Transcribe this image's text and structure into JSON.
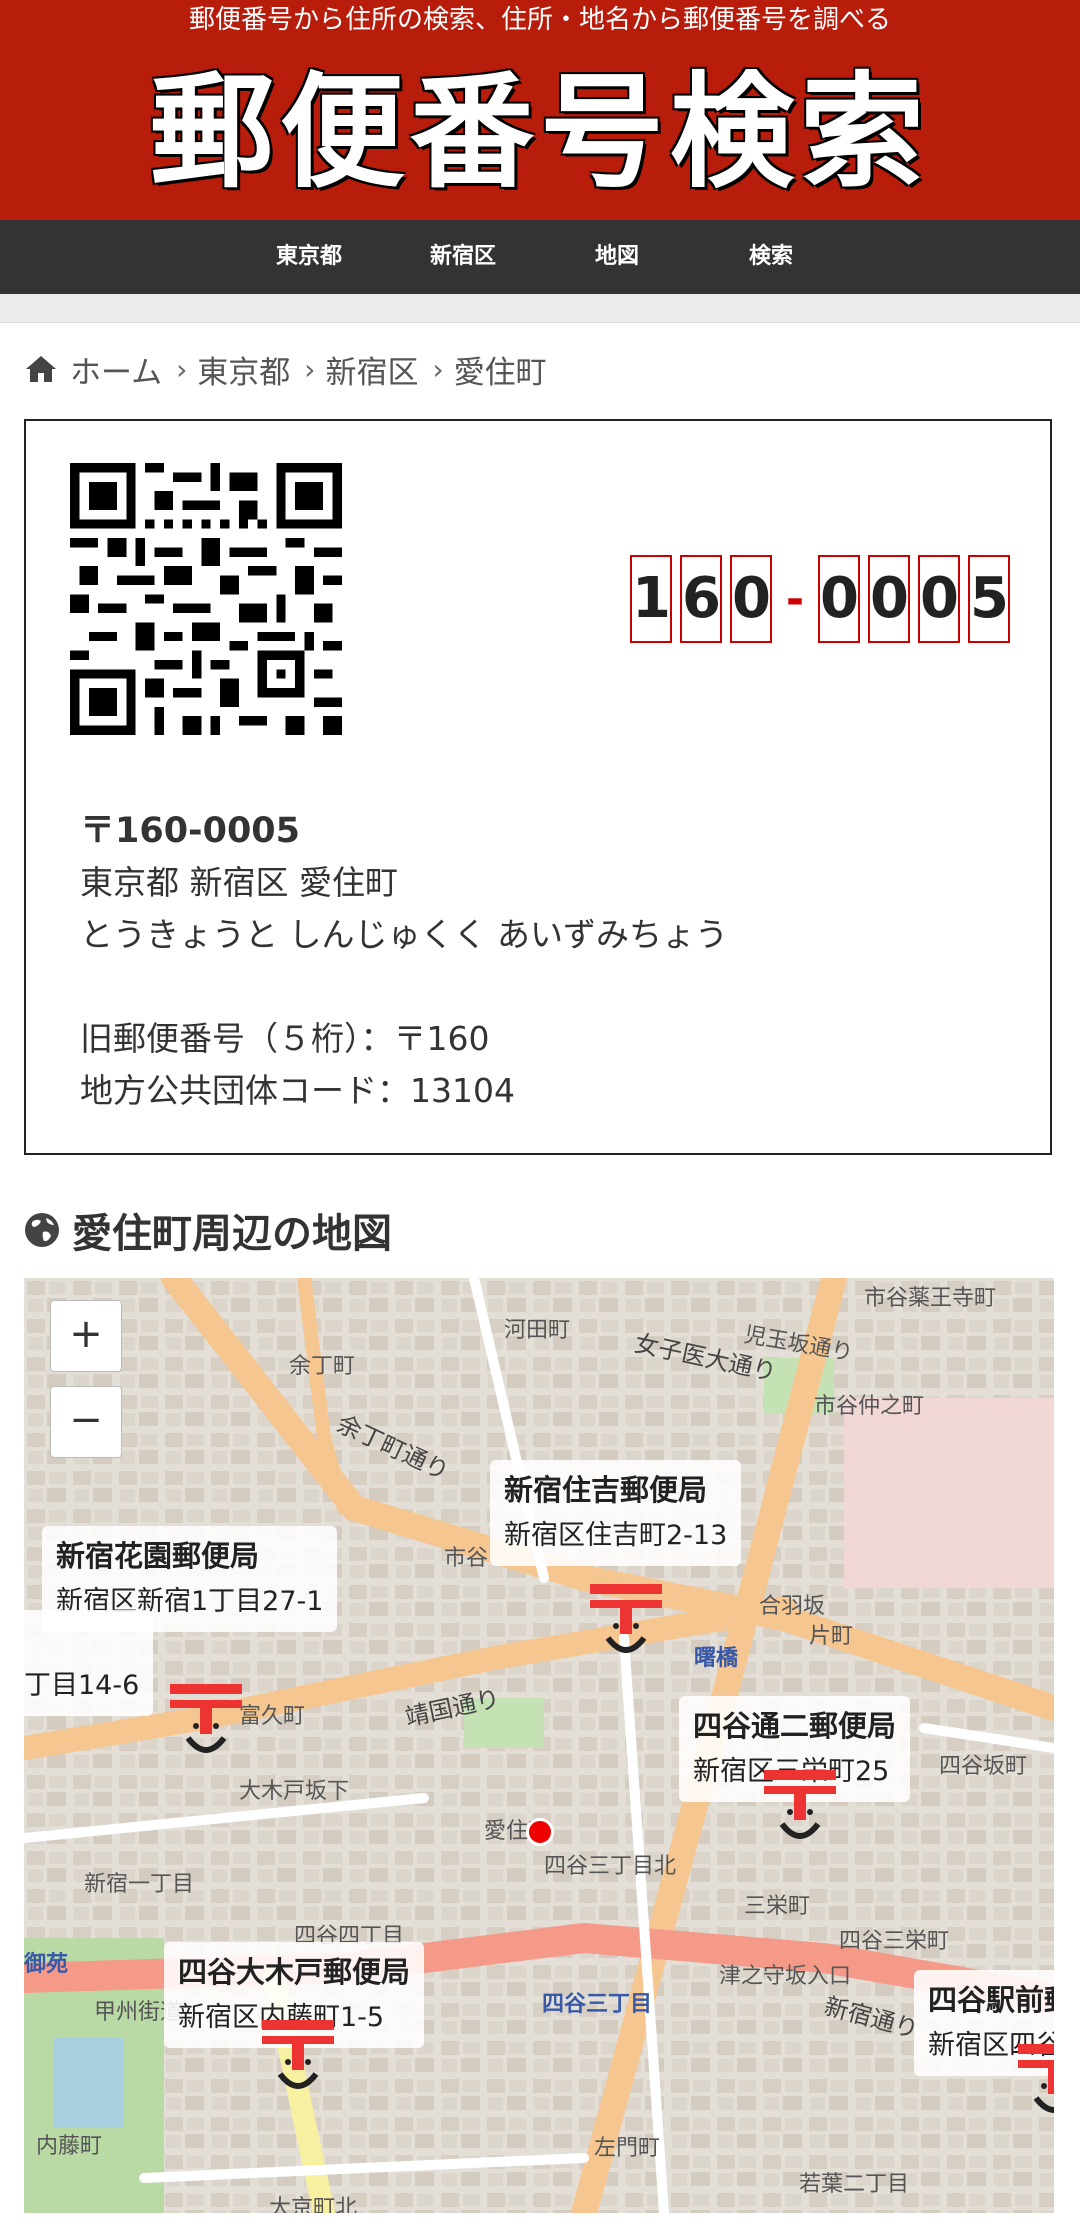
{
  "header": {
    "tagline": "郵便番号から住所の検索、住所・地名から郵便番号を調べる",
    "logo": "郵便番号検索",
    "color": "#b81c0b"
  },
  "nav": {
    "items": [
      {
        "label": "東京都"
      },
      {
        "label": "新宿区"
      },
      {
        "label": "地図"
      },
      {
        "label": "検索"
      }
    ]
  },
  "breadcrumb": {
    "home": "ホーム",
    "items": [
      "東京都",
      "新宿区",
      "愛住町"
    ]
  },
  "postal": {
    "digits": [
      "1",
      "6",
      "0",
      "0",
      "0",
      "0",
      "5"
    ],
    "zip_line": "〒160-0005",
    "address": "東京都 新宿区 愛住町",
    "reading": "とうきょうと しんじゅくく あいずみちょう",
    "old_zip": "旧郵便番号（５桁）：〒160",
    "local_code": "地方公共団体コード：13104"
  },
  "map": {
    "title": "愛住町周辺の地図",
    "zoom_in": "+",
    "zoom_out": "−",
    "popups": [
      {
        "name": "新宿住吉郵便局",
        "address": "新宿区住吉町2-13"
      },
      {
        "name": "新宿花園郵便局",
        "address": "新宿区新宿1丁目27-1"
      },
      {
        "name": "",
        "address": "丁目14-6"
      },
      {
        "name": "四谷通二郵便局",
        "address": "新宿区三栄町25"
      },
      {
        "name": "四谷大木戸郵便局",
        "address": "新宿区内藤町1-5"
      },
      {
        "name": "四谷駅前郵",
        "address": "新宿区四谷"
      }
    ],
    "places": [
      "市谷薬王寺町",
      "河田町",
      "余丁町",
      "女子医大通り",
      "児玉坂通り",
      "市谷仲之町",
      "余丁町通り",
      "市谷",
      "富久町",
      "合羽坂",
      "片町",
      "曙橋",
      "靖国通り",
      "四谷坂町",
      "大木戸坂下",
      "愛住町",
      "四谷三丁目北",
      "新宿一丁目",
      "四谷四丁目",
      "三栄町",
      "四谷三栄町",
      "四谷三丁目",
      "津之守坂入口",
      "新宿通り",
      "内藤町",
      "左門町",
      "若葉二丁目",
      "大京町北",
      "御苑",
      "甲州街道"
    ]
  }
}
